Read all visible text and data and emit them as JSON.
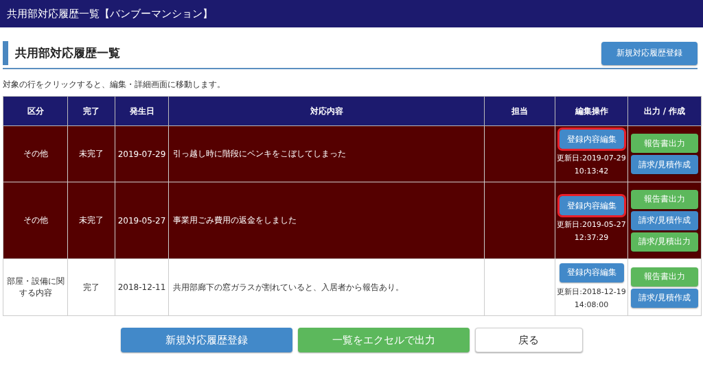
{
  "window": {
    "title": "共用部対応履歴一覧【バンブーマンション】"
  },
  "section": {
    "title": "共用部対応履歴一覧",
    "new_button": "新規対応履歴登録"
  },
  "note": "対象の行をクリックすると、編集・詳細画面に移動します。",
  "table": {
    "columns": [
      "区分",
      "完了",
      "発生日",
      "対応内容",
      "担当",
      "編集操作",
      "出力 / 作成"
    ],
    "rows": [
      {
        "alert": true,
        "category": "その他",
        "status": "未完了",
        "date": "2019-07-29",
        "content": "引っ越し時に階段にペンキをこぼしてしまった",
        "edit_button": "登録内容編集",
        "edit_highlighted": true,
        "updated": "更新日:2019-07-29",
        "updated_time": "10:13:42",
        "outputs": [
          {
            "label": "報告書出力",
            "kind": "success"
          },
          {
            "label": "請求/見積作成",
            "kind": "primary"
          }
        ]
      },
      {
        "alert": true,
        "category": "その他",
        "status": "未完了",
        "date": "2019-05-27",
        "content": "事業用ごみ費用の返金をしました",
        "edit_button": "登録内容編集",
        "edit_highlighted": true,
        "updated": "更新日:2019-05-27",
        "updated_time": "12:37:29",
        "outputs": [
          {
            "label": "報告書出力",
            "kind": "success"
          },
          {
            "label": "請求/見積作成",
            "kind": "primary"
          },
          {
            "label": "請求/見積出力",
            "kind": "success"
          }
        ]
      },
      {
        "alert": false,
        "category": "部屋・設備に関する内容",
        "status": "完了",
        "date": "2018-12-11",
        "content": "共用部廊下の窓ガラスが割れていると、入居者から報告あり。",
        "edit_button": "登録内容編集",
        "edit_highlighted": false,
        "updated": "更新日:2018-12-19",
        "updated_time": "14:08:00",
        "outputs": [
          {
            "label": "報告書出力",
            "kind": "success"
          },
          {
            "label": "請求/見積作成",
            "kind": "primary"
          }
        ]
      }
    ]
  },
  "footer_buttons": [
    {
      "label": "新規対応履歴登録",
      "kind": "primary"
    },
    {
      "label": "一覧をエクセルで出力",
      "kind": "success"
    },
    {
      "label": "戻る",
      "kind": "default"
    }
  ]
}
